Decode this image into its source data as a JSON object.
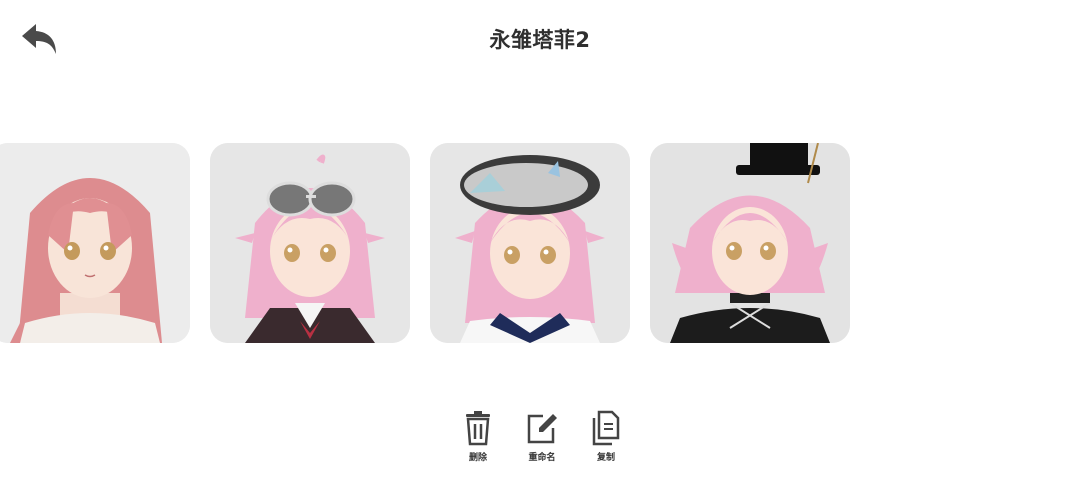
{
  "header": {
    "title": "永雏塔菲2",
    "back_icon": "back-arrow-icon"
  },
  "avatars": [
    {
      "name": "avatar-1",
      "hair_color": "#e79a9e",
      "style": "long-hair"
    },
    {
      "name": "avatar-2",
      "hair_color": "#f0b3cf",
      "style": "sunglasses"
    },
    {
      "name": "avatar-3",
      "hair_color": "#f0b3cf",
      "style": "beret-sailor"
    },
    {
      "name": "avatar-4",
      "hair_color": "#f0b3cf",
      "style": "top-hat-gothic"
    }
  ],
  "actions": {
    "delete": {
      "label": "删除",
      "icon": "trash-icon"
    },
    "rename": {
      "label": "重命名",
      "icon": "edit-icon"
    },
    "copy": {
      "label": "复制",
      "icon": "copy-icon"
    }
  },
  "colors": {
    "card_bg": "#e9e9e9",
    "icon": "#444444"
  }
}
